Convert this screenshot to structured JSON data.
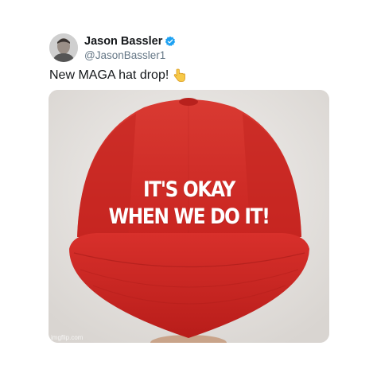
{
  "author": {
    "display_name": "Jason Bassler",
    "handle": "@JasonBassler1",
    "verified": true
  },
  "tweet": {
    "text": "New MAGA hat drop!",
    "emoji": "backhand-index-pointing-down"
  },
  "media": {
    "hat_line1": "IT'S OKAY",
    "hat_line2": "WHEN WE DO IT!",
    "watermark": "imgflip.com",
    "hat_color": "#d42a2a",
    "text_color": "#ffffff"
  },
  "colors": {
    "verified": "#1da1f2",
    "name": "#14171a",
    "handle": "#657786"
  }
}
